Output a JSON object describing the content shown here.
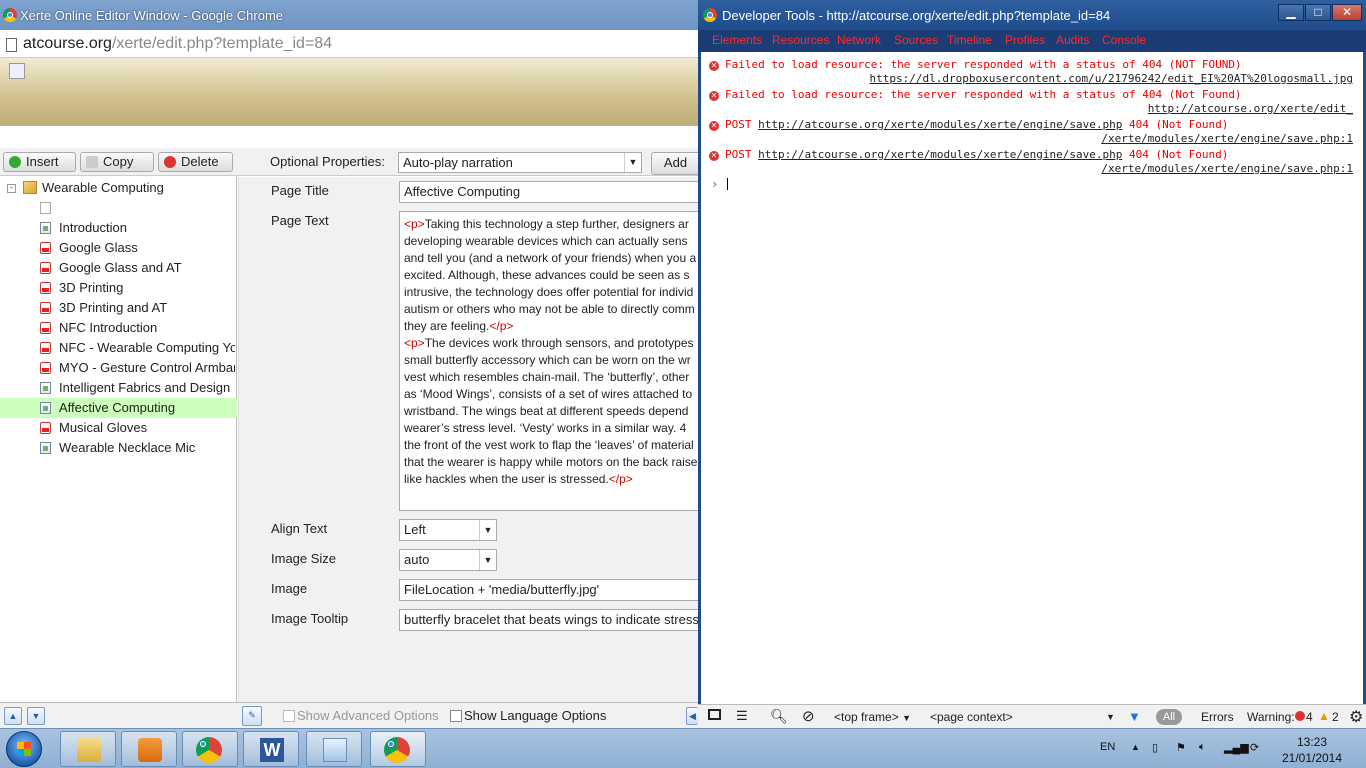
{
  "chrome": {
    "title": "Xerte Online Editor Window - Google Chrome",
    "url_domain": "atcourse.org",
    "url_path": "/xerte/edit.php?template_id=84"
  },
  "toolbar": {
    "insert": "Insert",
    "copy": "Copy",
    "delete": "Delete",
    "optional_properties_label": "Optional Properties:",
    "optional_properties_value": "Auto-play narration",
    "add": "Add"
  },
  "tree": {
    "root": "Wearable Computing",
    "items": [
      {
        "label": "Introduction",
        "icon": "page-icon"
      },
      {
        "label": "Google Glass",
        "icon": "youtube-icon"
      },
      {
        "label": "Google Glass and AT",
        "icon": "youtube-icon"
      },
      {
        "label": "3D Printing",
        "icon": "youtube-icon"
      },
      {
        "label": "3D Printing and AT",
        "icon": "youtube-icon"
      },
      {
        "label": "NFC Introduction",
        "icon": "youtube-icon"
      },
      {
        "label": "NFC - Wearable Computing You",
        "icon": "youtube-icon"
      },
      {
        "label": "MYO - Gesture Control Armband",
        "icon": "youtube-icon"
      },
      {
        "label": "Intelligent Fabrics and Design",
        "icon": "page-icon"
      },
      {
        "label": "Affective Computing",
        "icon": "page-icon",
        "selected": true
      },
      {
        "label": "Musical Gloves",
        "icon": "youtube-icon"
      },
      {
        "label": "Wearable Necklace Mic",
        "icon": "page-icon"
      }
    ]
  },
  "properties": {
    "page_title_label": "Page Title",
    "page_title_value": "Affective Computing",
    "page_text_label": "Page Text",
    "page_text_lines": [
      {
        "open": "<p>",
        "text": "Taking this technology a step further,  designers ar",
        "close": ""
      },
      {
        "open": "",
        "text": "developing  wearable devices which can actually sens",
        "close": ""
      },
      {
        "open": "",
        "text": "and tell you (and a network of your friends) when you a",
        "close": ""
      },
      {
        "open": "",
        "text": "excited. Although, these advances could be seen as s",
        "close": ""
      },
      {
        "open": "",
        "text": "intrusive, the technology does offer potential for individ",
        "close": ""
      },
      {
        "open": "",
        "text": "autism or others who may not be able to directly comm",
        "close": ""
      },
      {
        "open": "",
        "text": "they are feeling.",
        "close": "</p>"
      },
      {
        "open": "<p>",
        "text": "The devices work through sensors, and prototypes",
        "close": ""
      },
      {
        "open": "",
        "text": "small butterfly accessory which can be worn on the wr",
        "close": ""
      },
      {
        "open": "",
        "text": "vest which resembles chain-mail. The ‘butterfly’, other",
        "close": ""
      },
      {
        "open": "",
        "text": "as ‘Mood Wings’, consists of a set of wires attached to",
        "close": ""
      },
      {
        "open": "",
        "text": "wristband. The wings beat at different speeds depend",
        "close": ""
      },
      {
        "open": "",
        "text": "wearer’s stress level. ‘Vesty’ works in a similar way. 4",
        "close": ""
      },
      {
        "open": "",
        "text": "the front of the vest work to flap the ‘leaves’ of material",
        "close": ""
      },
      {
        "open": "",
        "text": "that the wearer is happy while motors on the back raise",
        "close": ""
      },
      {
        "open": "",
        "text": "like hackles when the user is stressed.",
        "close": "</p>"
      }
    ],
    "align_text_label": "Align Text",
    "align_text_value": "Left",
    "image_size_label": "Image Size",
    "image_size_value": "auto",
    "image_label": "Image",
    "image_value": "FileLocation + 'media/butterfly.jpg'",
    "image_tooltip_label": "Image Tooltip",
    "image_tooltip_value": "butterfly bracelet that beats wings to indicate stress of"
  },
  "bottom": {
    "show_advanced": "Show Advanced Options",
    "show_language": "Show Language Options"
  },
  "devtools": {
    "title": "Developer Tools - http://atcourse.org/xerte/edit.php?template_id=84",
    "tabs": [
      "Elements",
      "Resources",
      "Network",
      "Sources",
      "Timeline",
      "Profiles",
      "Audits",
      "Console"
    ],
    "messages": [
      {
        "prefix": "Failed to load resource: the server responded with a status of 404 (NOT FOUND)",
        "link": "",
        "suffix": "",
        "source": "https://dl.dropboxusercontent.com/u/21796242/edit_EI%20AT%20logosmall.jpg"
      },
      {
        "prefix": "Failed to load resource: the server responded with a status of 404 (Not Found)",
        "link": "",
        "suffix": "",
        "source": "http://atcourse.org/xerte/edit_"
      },
      {
        "prefix": "POST ",
        "link": "http://atcourse.org/xerte/modules/xerte/engine/save.php",
        "suffix": " 404 (Not Found)",
        "source": "/xerte/modules/xerte/engine/save.php:1"
      },
      {
        "prefix": "POST ",
        "link": "http://atcourse.org/xerte/modules/xerte/engine/save.php",
        "suffix": " 404 (Not Found)",
        "source": "/xerte/modules/xerte/engine/save.php:1"
      }
    ],
    "prompt": "›",
    "status": {
      "frame": "<top frame>",
      "context": "<page context>",
      "all": "All",
      "errors": "Errors",
      "warnings": "Warning:",
      "error_count": "4",
      "warning_count": "2"
    }
  },
  "taskbar": {
    "language": "EN",
    "time": "13:23",
    "date": "21/01/2014"
  }
}
